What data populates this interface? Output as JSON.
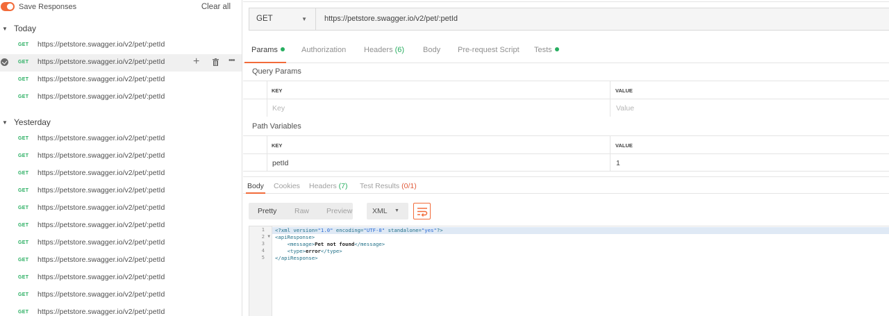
{
  "sidebar": {
    "save_responses_label": "Save Responses",
    "clear_all_label": "Clear all",
    "groups": [
      {
        "title": "Today",
        "items": [
          {
            "method": "GET",
            "url": "https://petstore.swagger.io/v2/pet/:petId"
          },
          {
            "method": "GET",
            "url": "https://petstore.swagger.io/v2/pet/:petId"
          },
          {
            "method": "GET",
            "url": "https://petstore.swagger.io/v2/pet/:petId"
          },
          {
            "method": "GET",
            "url": "https://petstore.swagger.io/v2/pet/:petId"
          }
        ]
      },
      {
        "title": "Yesterday",
        "items": [
          {
            "method": "GET",
            "url": "https://petstore.swagger.io/v2/pet/:petId"
          },
          {
            "method": "GET",
            "url": "https://petstore.swagger.io/v2/pet/:petId"
          },
          {
            "method": "GET",
            "url": "https://petstore.swagger.io/v2/pet/:petId"
          },
          {
            "method": "GET",
            "url": "https://petstore.swagger.io/v2/pet/:petId"
          },
          {
            "method": "GET",
            "url": "https://petstore.swagger.io/v2/pet/:petId"
          },
          {
            "method": "GET",
            "url": "https://petstore.swagger.io/v2/pet/:petId"
          },
          {
            "method": "GET",
            "url": "https://petstore.swagger.io/v2/pet/:petId"
          },
          {
            "method": "GET",
            "url": "https://petstore.swagger.io/v2/pet/:petId"
          },
          {
            "method": "GET",
            "url": "https://petstore.swagger.io/v2/pet/:petId"
          },
          {
            "method": "GET",
            "url": "https://petstore.swagger.io/v2/pet/:petId"
          },
          {
            "method": "GET",
            "url": "https://petstore.swagger.io/v2/pet/:petId"
          }
        ]
      }
    ],
    "item_actions": [
      "plus-icon",
      "trash-icon",
      "more-icon"
    ]
  },
  "request": {
    "method": "GET",
    "url": "https://petstore.swagger.io/v2/pet/:petId",
    "tabs": {
      "params": "Params",
      "authorization": "Authorization",
      "headers": "Headers",
      "headers_count": "(6)",
      "body": "Body",
      "prerequest": "Pre-request Script",
      "tests": "Tests"
    },
    "query_params": {
      "title": "Query Params",
      "key_header": "KEY",
      "value_header": "VALUE",
      "key_placeholder": "Key",
      "value_placeholder": "Value"
    },
    "path_variables": {
      "title": "Path Variables",
      "key_header": "KEY",
      "value_header": "VALUE",
      "rows": [
        {
          "key": "petId",
          "value": "1"
        }
      ]
    }
  },
  "response": {
    "tabs": {
      "body": "Body",
      "cookies": "Cookies",
      "headers": "Headers",
      "headers_count": "(7)",
      "test_results": "Test Results",
      "test_results_count": "(0/1)"
    },
    "view_modes": {
      "pretty": "Pretty",
      "raw": "Raw",
      "preview": "Preview"
    },
    "format": "XML",
    "code_lines": [
      {
        "n": "1",
        "text": "<?xml version=\"1.0\" encoding=\"UTF-8\" standalone=\"yes\"?>"
      },
      {
        "n": "2",
        "text": "<apiResponse>"
      },
      {
        "n": "3",
        "text": "    <message>Pet not found</message>"
      },
      {
        "n": "4",
        "text": "    <type>error</type>"
      },
      {
        "n": "5",
        "text": "</apiResponse>"
      }
    ]
  },
  "colors": {
    "accent": "#f26b3a",
    "get_method": "#27ae60",
    "status_dot": "#27ae60"
  }
}
